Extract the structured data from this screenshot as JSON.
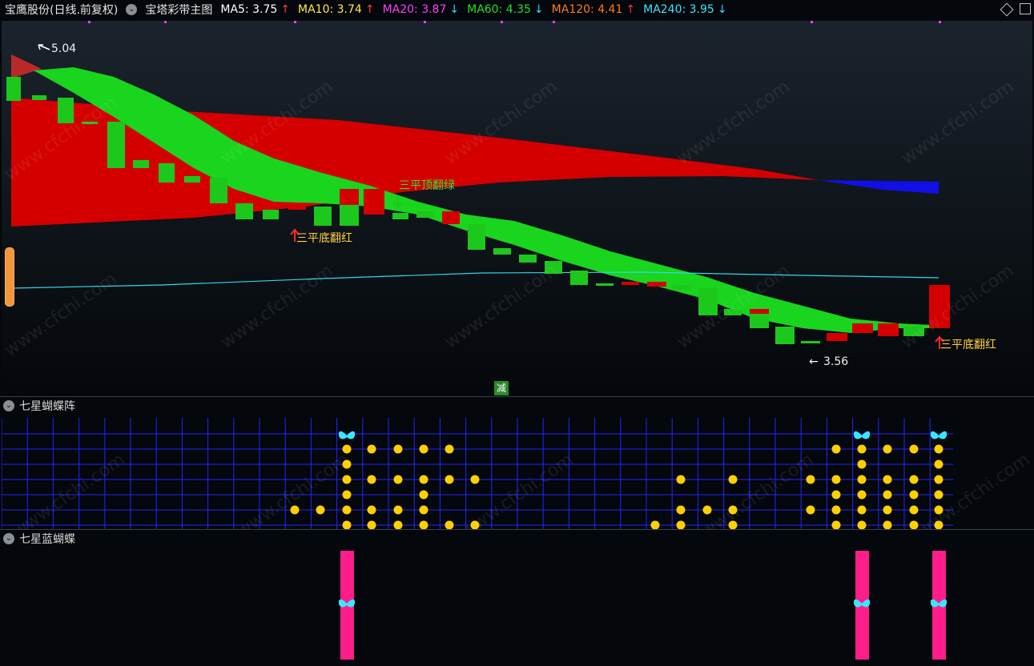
{
  "header": {
    "stock_title": "宝鹰股份(日线.前复权)",
    "indicator_title": "宝塔彩带主图",
    "ma": [
      {
        "label": "MA5: 3.75",
        "arrow": "↑",
        "arrow_color": "#ff3b3b",
        "color": "#ffffff"
      },
      {
        "label": "MA10: 3.74",
        "arrow": "↑",
        "arrow_color": "#ff3b3b",
        "color": "#ffe94a"
      },
      {
        "label": "MA20: 3.87",
        "arrow": "↓",
        "arrow_color": "#3ad3ff",
        "color": "#ff3cff"
      },
      {
        "label": "MA60: 4.35",
        "arrow": "↓",
        "arrow_color": "#3ad3ff",
        "color": "#22e02b"
      },
      {
        "label": "MA120: 4.41",
        "arrow": "↑",
        "arrow_color": "#ff3b3b",
        "color": "#ff7a1c"
      },
      {
        "label": "MA240: 3.95",
        "arrow": "↓",
        "arrow_color": "#3ad3ff",
        "color": "#39e6ff"
      }
    ],
    "icons": [
      "diamond-icon",
      "window-restore-icon"
    ]
  },
  "main_chart": {
    "high_label": "5.04",
    "low_label": "3.56",
    "arrow_left": "←",
    "annotation_top_green": "三平顶翻绿",
    "annotation_bottom_red_1": "三平底翻红",
    "annotation_bottom_red_2": "三平底翻红",
    "reduce_badge": "减",
    "colors": {
      "green_band": "#19d51d",
      "red_band": "#d40000",
      "blue_band": "#1010e6",
      "cyan_line": "#34d6e6",
      "candle_green": "#1cc81c",
      "candle_red": "#d40000"
    }
  },
  "panel2": {
    "title": "七星蝴蝶阵",
    "grid_color": "#1f22ff",
    "dot_color": "#ffd000",
    "butterfly_icon": "butterfly-icon"
  },
  "panel3": {
    "title": "七星蓝蝴蝶",
    "bar_color": "#ff1d8a",
    "butterfly_icon": "butterfly-icon"
  }
}
